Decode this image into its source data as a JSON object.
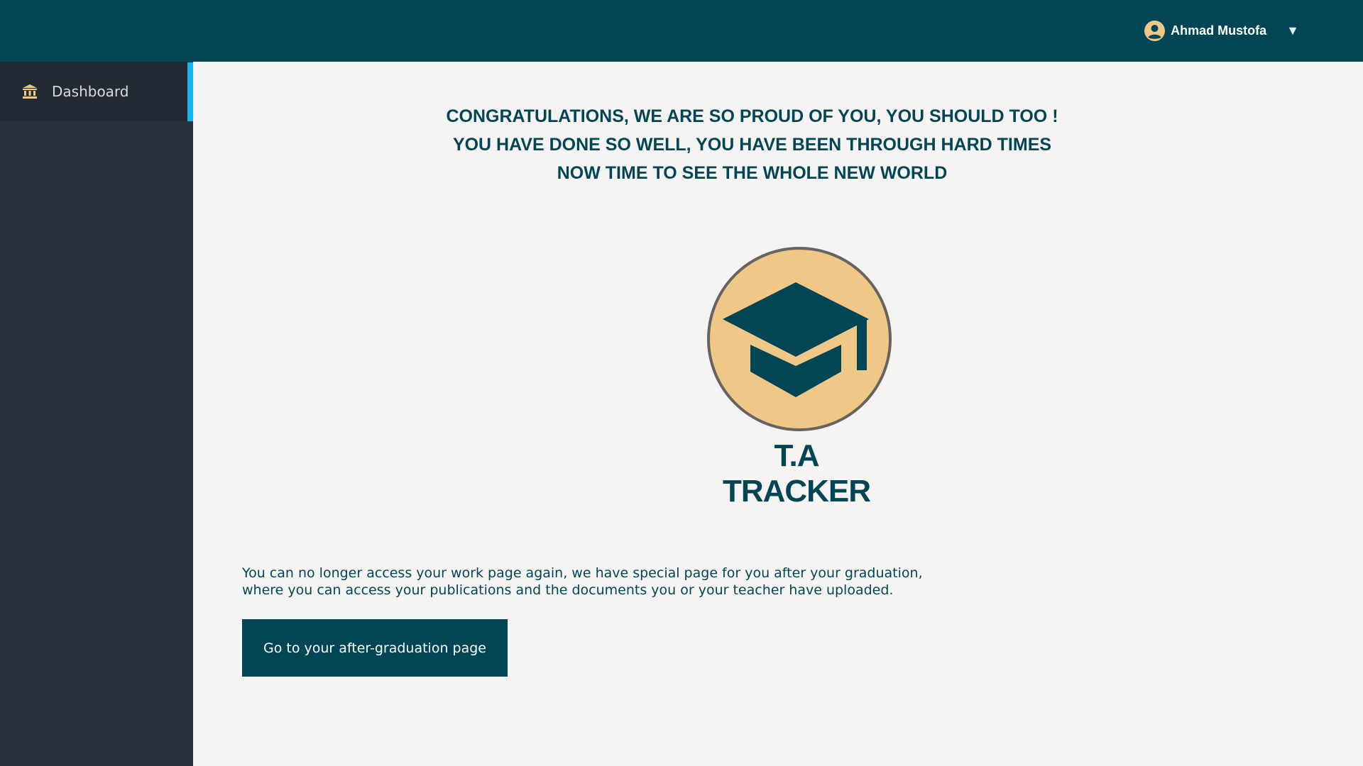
{
  "header": {
    "user_name": "Ahmad Mustofa",
    "user_icon": "user-circle-icon",
    "caret": "▼",
    "caret_icon": "caret-down-icon"
  },
  "sidebar": {
    "items": [
      {
        "label": "Dashboard",
        "icon": "bank-icon",
        "active": true
      }
    ]
  },
  "main": {
    "headline_lines": [
      "CONGRATULATIONS, WE ARE SO PROUD OF YOU, YOU SHOULD TOO !",
      "YOU HAVE DONE SO WELL, YOU HAVE BEEN THROUGH HARD TIMES",
      "NOW TIME TO SEE THE WHOLE NEW WORLD"
    ],
    "logo": {
      "icon": "graduation-cap-icon",
      "brand_name": "T.A TRACKER"
    },
    "note_lines": [
      "You can no longer access your work page again, we have special page for you after your graduation,",
      "where you can access your publications and the documents you or your teacher have uploaded."
    ],
    "cta_label": "Go to your after-graduation page"
  },
  "colors": {
    "topbar": "#024656",
    "sidebar": "#2b313c",
    "sidebar_active": "#232a33",
    "active_indicator": "#19b5ef",
    "accent_gold": "#efc888",
    "text_primary": "#024656",
    "background": "#f5f4f2"
  }
}
